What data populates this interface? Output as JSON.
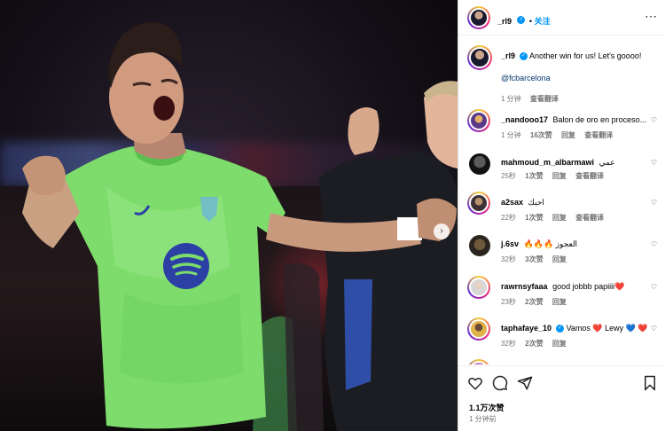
{
  "post": {
    "author": "_rl9",
    "follow_label": "关注",
    "caption_author": "_rl9",
    "caption": "Another win for us! Let's goooo!",
    "mention": "@fcbarcelona",
    "caption_time": "1 分钟",
    "caption_translate": "查看翻译",
    "likes": "1.1万次赞",
    "posted_time": "1 分钟前"
  },
  "comments": [
    {
      "user": "_nandooo17",
      "text": "Balon de oro en proceso...",
      "time": "1 分钟",
      "likes": "16次赞",
      "reply": "回复",
      "translate": "查看翻译"
    },
    {
      "user": "mahmoud_m_albarmawi",
      "text": "عمي",
      "time": "25秒",
      "likes": "1次赞",
      "reply": "回复",
      "translate": "查看翻译"
    },
    {
      "user": "a2sax",
      "text": "احبك",
      "time": "22秒",
      "likes": "1次赞",
      "reply": "回复",
      "translate": "查看翻译"
    },
    {
      "user": "j.6sv",
      "text": "🔥🔥🔥 العجوز",
      "time": "32秒",
      "likes": "3次赞",
      "reply": "回复"
    },
    {
      "user": "rawrnsyfaaa",
      "text": "good jobbb papiiii❤️",
      "time": "23秒",
      "likes": "2次赞",
      "reply": "回复"
    },
    {
      "user": "taphafaye_10",
      "text": "Vamos ❤️ Lewy 💙 ❤️",
      "time": "32秒",
      "likes": "2次赞",
      "reply": "回复"
    }
  ],
  "icons": {
    "more": "⋯",
    "heart": "♡",
    "comment": "comment-icon",
    "share": "share-icon",
    "bookmark": "bookmark-icon",
    "next": "›"
  },
  "colors": {
    "link": "#0095f6",
    "jersey": "#7ddc6b",
    "muted": "#737373"
  }
}
